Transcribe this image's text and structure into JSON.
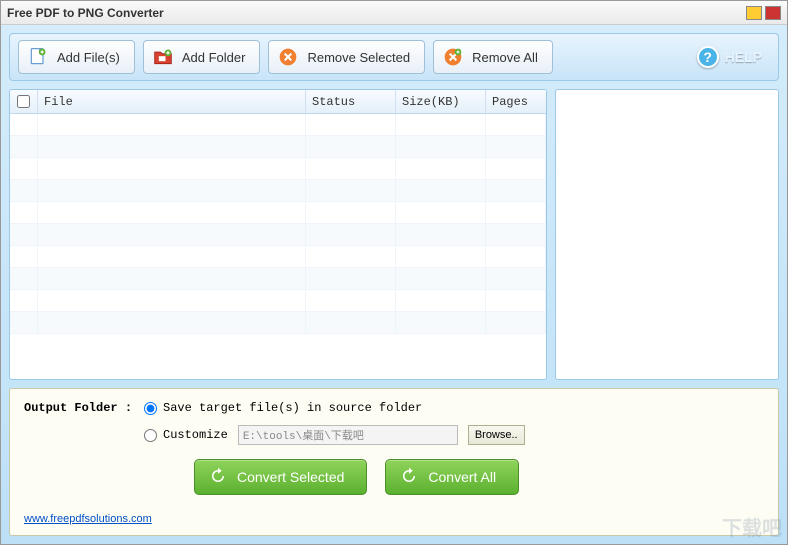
{
  "window": {
    "title": "Free PDF to PNG Converter"
  },
  "toolbar": {
    "add_files": "Add File(s)",
    "add_folder": "Add Folder",
    "remove_selected": "Remove Selected",
    "remove_all": "Remove All",
    "help": "HELP"
  },
  "table": {
    "headers": {
      "file": "File",
      "status": "Status",
      "size": "Size(KB)",
      "pages": "Pages"
    },
    "rows": []
  },
  "output": {
    "label": "Output Folder :",
    "opt_source": "Save target file(s) in source folder",
    "opt_custom": "Customize",
    "selected": "source",
    "custom_path": "E:\\tools\\桌面\\下载吧",
    "browse": "Browse.."
  },
  "actions": {
    "convert_selected": "Convert Selected",
    "convert_all": "Convert All"
  },
  "footer": {
    "link": "www.freepdfsolutions.com"
  },
  "watermark": "下载吧"
}
